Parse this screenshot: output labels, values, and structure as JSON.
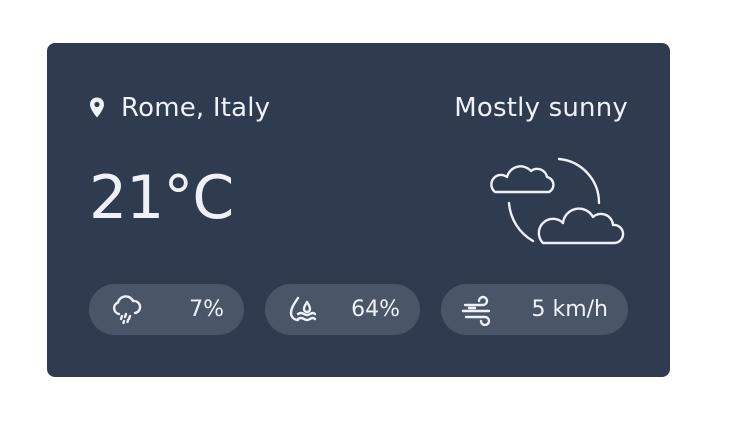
{
  "weather": {
    "location": "Rome, Italy",
    "condition": "Mostly sunny",
    "temperature": "21°C",
    "condition_icon": "cloud-sun-icon",
    "stats": {
      "precipitation": {
        "icon": "cloud-rain-icon",
        "value": "7%"
      },
      "humidity": {
        "icon": "humidity-icon",
        "value": "64%"
      },
      "wind": {
        "icon": "wind-icon",
        "value": "5 km/h"
      }
    }
  },
  "colors": {
    "card_background": "#2f3b4f",
    "pill_background": "#4a5568",
    "text": "#eef1f7"
  }
}
